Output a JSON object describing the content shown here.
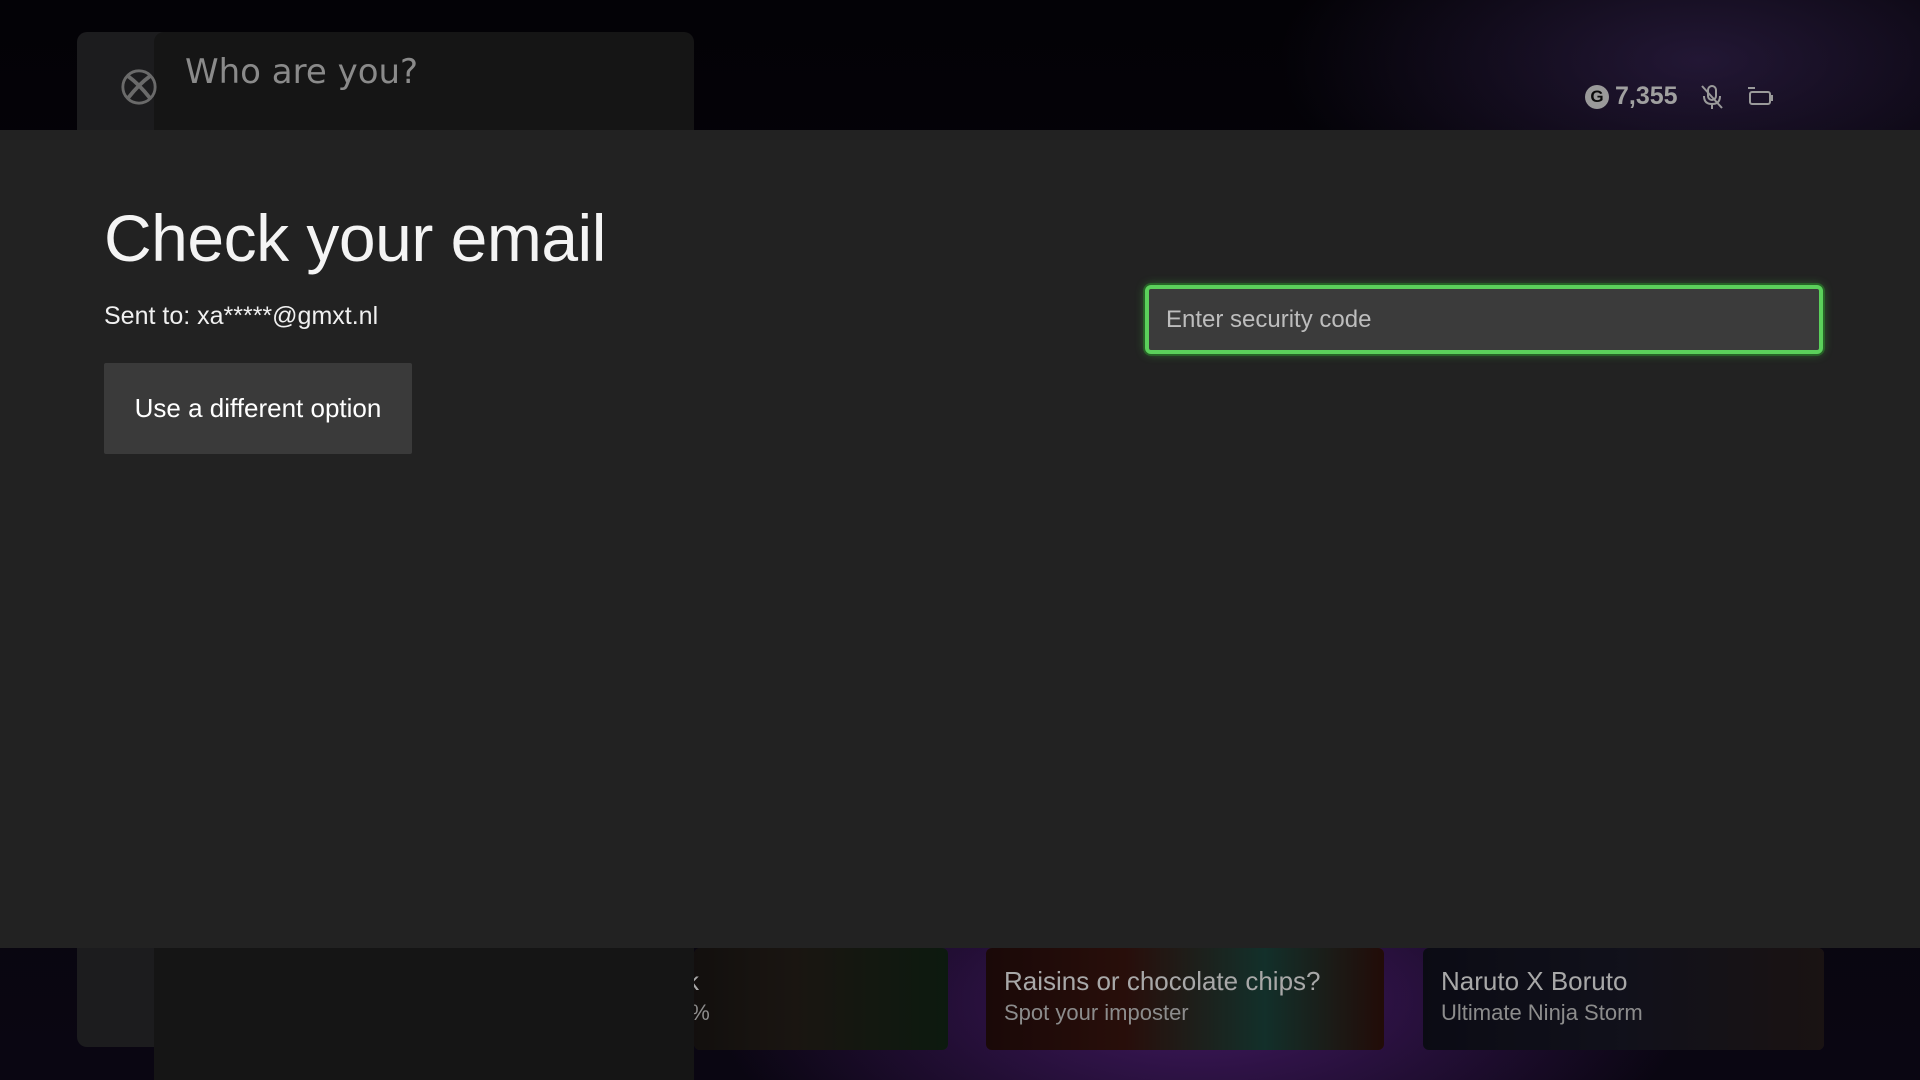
{
  "background": {
    "title": "Who are you?",
    "gamerscore": "7,355",
    "gamerscore_badge": "G",
    "tiles": [
      {
        "title": "k",
        "subtitle": "0%"
      },
      {
        "title": "Raisins or chocolate chips?",
        "subtitle": "Spot your imposter"
      },
      {
        "title": "Naruto X Boruto",
        "subtitle": "Ultimate Ninja Storm"
      }
    ],
    "icons": [
      "xbox-logo-icon",
      "mic-muted-icon",
      "battery-icon"
    ]
  },
  "dialog": {
    "title": "Check your email",
    "sent_to": "Sent to: xa*****@gmxt.nl",
    "alt_option_label": "Use a different option",
    "security_code": {
      "value": "",
      "placeholder": "Enter security code"
    }
  },
  "colors": {
    "focus_green": "#5bd05b",
    "dialog_bg": "#222222",
    "button_bg": "#3a3a3a"
  }
}
